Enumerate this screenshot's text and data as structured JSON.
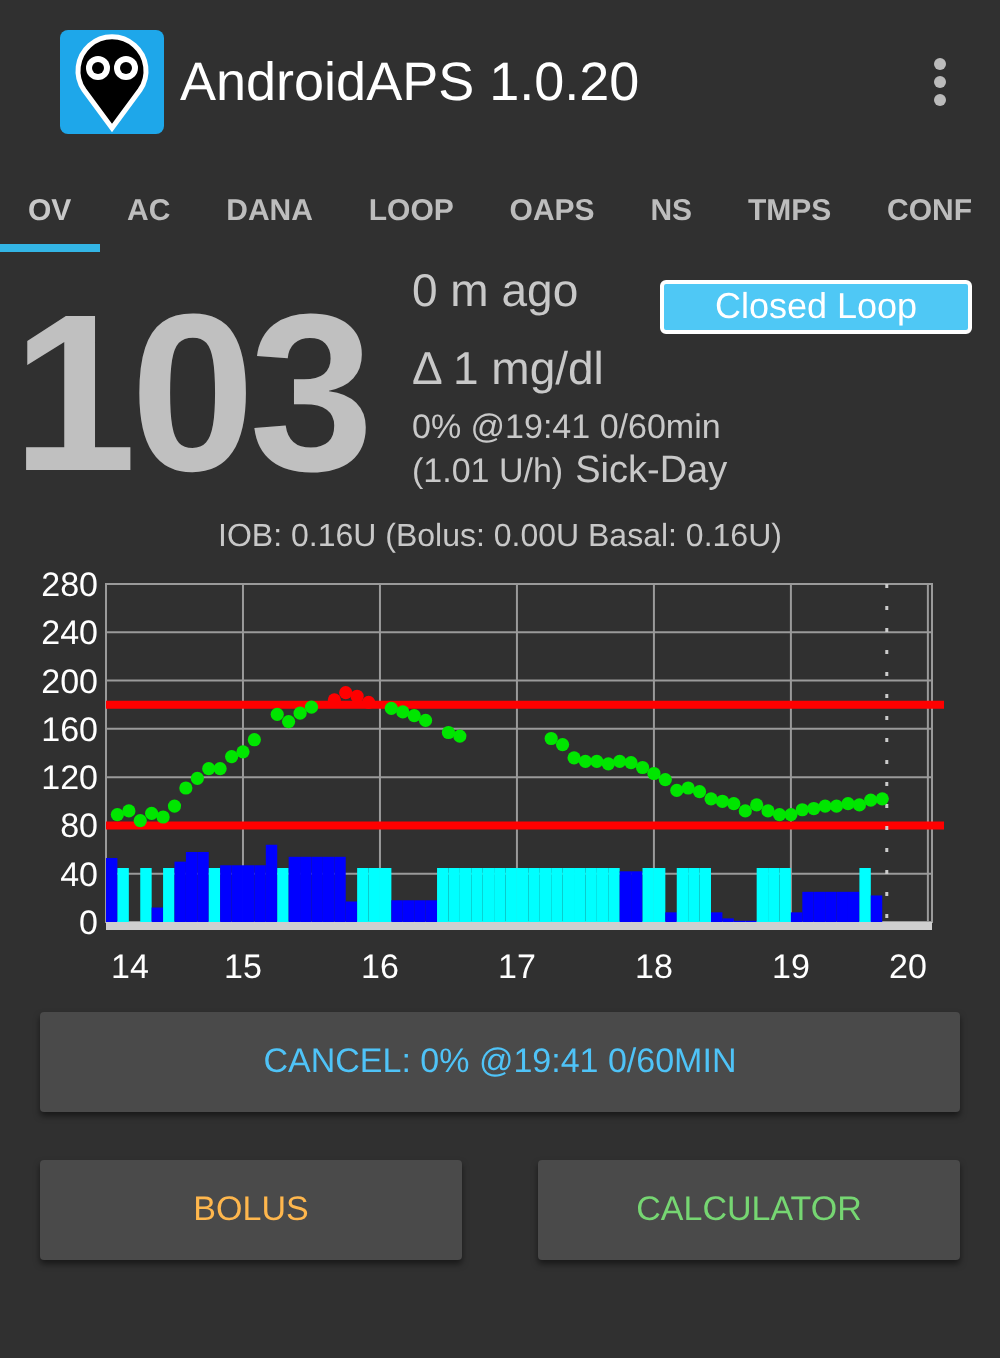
{
  "app_bar": {
    "title": "AndroidAPS 1.0.20"
  },
  "tabs": [
    {
      "label": "OV",
      "selected": true
    },
    {
      "label": "AC",
      "selected": false
    },
    {
      "label": "DANA",
      "selected": false
    },
    {
      "label": "LOOP",
      "selected": false
    },
    {
      "label": "OAPS",
      "selected": false
    },
    {
      "label": "NS",
      "selected": false
    },
    {
      "label": "TMPS",
      "selected": false
    },
    {
      "label": "CONF",
      "selected": false
    }
  ],
  "glucose": {
    "value": "103",
    "age": "0 m ago",
    "delta": "Δ 1 mg/dl",
    "temp_basal": "0% @19:41 0/60min",
    "basal_rate": "(1.01 U/h)",
    "profile": "Sick-Day"
  },
  "loop_mode": {
    "label": "Closed Loop"
  },
  "iob": "IOB: 0.16U (Bolus: 0.00U Basal: 0.16U)",
  "graph": {
    "chart_data": {
      "type": "scatter",
      "x": [
        14.083,
        14.167,
        14.25,
        14.333,
        14.417,
        14.5,
        14.583,
        14.667,
        14.75,
        14.833,
        14.917,
        15,
        15.083,
        15.25,
        15.333,
        15.417,
        15.5,
        15.667,
        15.75,
        15.833,
        15.917,
        16.083,
        16.167,
        16.25,
        16.333,
        16.5,
        16.583,
        17.25,
        17.333,
        17.417,
        17.5,
        17.583,
        17.667,
        17.75,
        17.833,
        17.917,
        18,
        18.083,
        18.167,
        18.25,
        18.333,
        18.417,
        18.5,
        18.583,
        18.667,
        18.75,
        18.833,
        18.917,
        19,
        19.083,
        19.167,
        19.25,
        19.333,
        19.417,
        19.5,
        19.583,
        19.667
      ],
      "series": [
        {
          "color": "#00e600",
          "values": [
            89,
            92,
            84,
            90,
            87,
            96,
            111,
            119,
            127,
            127,
            137,
            141,
            151,
            172,
            166,
            173,
            178,
            null,
            null,
            null,
            null,
            177,
            174,
            171,
            167,
            157,
            154,
            152,
            147,
            136,
            133,
            133,
            131,
            133,
            132,
            128,
            123,
            118,
            109,
            111,
            108,
            102,
            100,
            98,
            92,
            97,
            92,
            89,
            89,
            93,
            94,
            96,
            96,
            98,
            97,
            101,
            102
          ]
        },
        {
          "color": "#ff0000",
          "values": [
            null,
            null,
            null,
            null,
            null,
            null,
            null,
            null,
            null,
            null,
            null,
            null,
            null,
            null,
            null,
            null,
            null,
            184,
            190,
            187,
            182,
            null,
            null,
            null,
            null,
            null,
            null,
            null,
            null,
            null,
            null,
            null,
            null,
            null,
            null,
            null,
            null,
            null,
            null,
            null,
            null,
            null,
            null,
            null,
            null,
            null,
            null,
            null,
            null,
            null,
            null,
            null,
            null,
            null,
            null,
            null,
            null
          ]
        }
      ],
      "xlim": [
        14,
        20.03
      ],
      "ylim": [
        0,
        280
      ],
      "xticks": [
        14,
        15,
        16,
        17,
        18,
        19,
        20
      ],
      "yticks": [
        0,
        40,
        80,
        120,
        160,
        200,
        240,
        280
      ],
      "grid": true,
      "ref_lines": [
        {
          "axis": "y",
          "value": 180,
          "color": "#ff0000"
        },
        {
          "axis": "y",
          "value": 80,
          "color": "#ff0000"
        },
        {
          "axis": "x",
          "value": 19.7,
          "color": "#cccccc"
        }
      ]
    }
  },
  "buttons": [
    {
      "label": "CANCEL: 0% @19:41 0/60MIN",
      "kind": "cancel"
    },
    {
      "label": "BOLUS",
      "kind": "bolus"
    },
    {
      "label": "CALCULATOR",
      "kind": "calculator"
    }
  ]
}
